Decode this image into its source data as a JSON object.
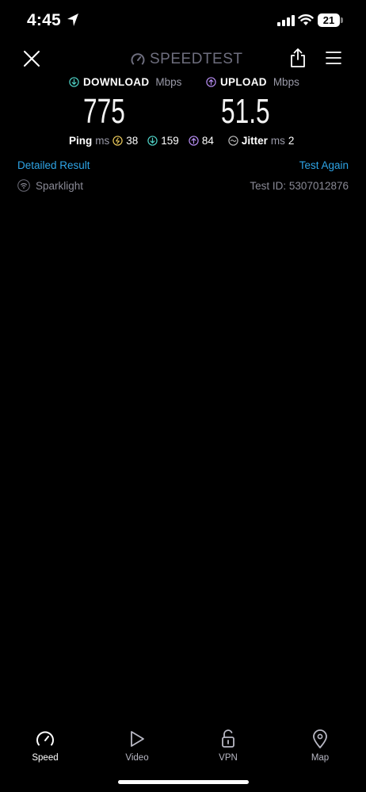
{
  "status_bar": {
    "time": "4:45",
    "battery": "21"
  },
  "header": {
    "brand": "SPEEDTEST"
  },
  "download": {
    "label": "DOWNLOAD",
    "unit": "Mbps",
    "value": "775"
  },
  "upload": {
    "label": "UPLOAD",
    "unit": "Mbps",
    "value": "51.5"
  },
  "ping": {
    "label": "Ping",
    "unit": "ms",
    "idle": "38",
    "download": "159",
    "upload": "84"
  },
  "jitter": {
    "label": "Jitter",
    "unit": "ms",
    "value": "2"
  },
  "links": {
    "detailed": "Detailed Result",
    "again": "Test Again"
  },
  "connection": {
    "isp": "Sparklight",
    "test_id": "Test ID: 5307012876"
  },
  "tabs": [
    {
      "label": "Speed",
      "icon": "gauge-icon"
    },
    {
      "label": "Video",
      "icon": "play-icon"
    },
    {
      "label": "VPN",
      "icon": "lock-icon"
    },
    {
      "label": "Map",
      "icon": "map-pin-icon"
    }
  ],
  "colors": {
    "accent": "#2ea4e6",
    "download": "#4fd1c5",
    "upload": "#b58cf0",
    "ping_idle": "#e8c75a"
  }
}
